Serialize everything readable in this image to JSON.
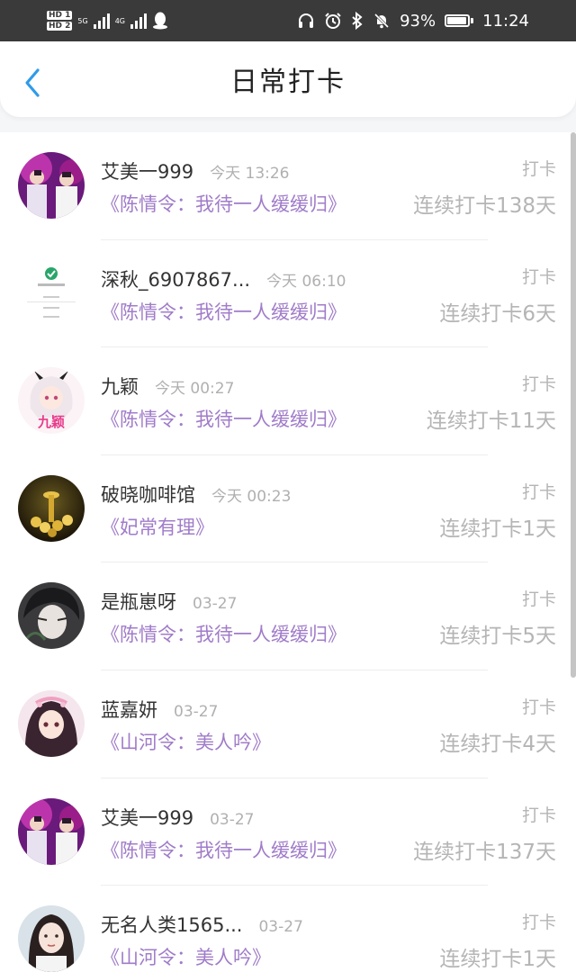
{
  "status_bar": {
    "sim1": "HD 1",
    "sim2": "HD 2",
    "net1": "5G",
    "net2": "4G",
    "battery_percent": "93%",
    "battery_level": 0.93,
    "time": "11:24",
    "icons": [
      "headphones-icon",
      "alarm-icon",
      "bluetooth-icon",
      "mute-bell-icon",
      "battery-icon",
      "qq-icon"
    ]
  },
  "header": {
    "title": "日常打卡",
    "back_icon": "chevron-left-icon",
    "accent": "#2f9be8"
  },
  "colors": {
    "book_link": "#a07cc9",
    "muted": "#b5b5b5"
  },
  "checkins": [
    {
      "user": "艾美一999",
      "time": "今天 13:26",
      "book": "《陈情令：我待一人缓缓归》",
      "action": "打卡",
      "streak": "连续打卡138天",
      "avatar": "stage-duo"
    },
    {
      "user": "深秋_6907867...",
      "time": "今天 06:10",
      "book": "《陈情令：我待一人缓缓归》",
      "action": "打卡",
      "streak": "连续打卡6天",
      "avatar": "checkmark-screen"
    },
    {
      "user": "九颖",
      "time": "今天 00:27",
      "book": "《陈情令：我待一人缓缓归》",
      "action": "打卡",
      "streak": "连续打卡11天",
      "avatar": "anime-girl"
    },
    {
      "user": "破晓咖啡馆",
      "time": "今天 00:23",
      "book": "《妃常有理》",
      "action": "打卡",
      "streak": "连续打卡1天",
      "avatar": "gold-coins"
    },
    {
      "user": "是瓶崽呀",
      "time": "03-27",
      "book": "《陈情令：我待一人缓缓归》",
      "action": "打卡",
      "streak": "连续打卡5天",
      "avatar": "dark-portrait"
    },
    {
      "user": "蓝嘉妍",
      "time": "03-27",
      "book": "《山河令：美人吟》",
      "action": "打卡",
      "streak": "连续打卡4天",
      "avatar": "anime-princess"
    },
    {
      "user": "艾美一999",
      "time": "03-27",
      "book": "《陈情令：我待一人缓缓归》",
      "action": "打卡",
      "streak": "连续打卡137天",
      "avatar": "stage-duo"
    },
    {
      "user": "无名人类1565...",
      "time": "03-27",
      "book": "《山河令：美人吟》",
      "action": "打卡",
      "streak": "连续打卡1天",
      "avatar": "actress-portrait"
    }
  ]
}
